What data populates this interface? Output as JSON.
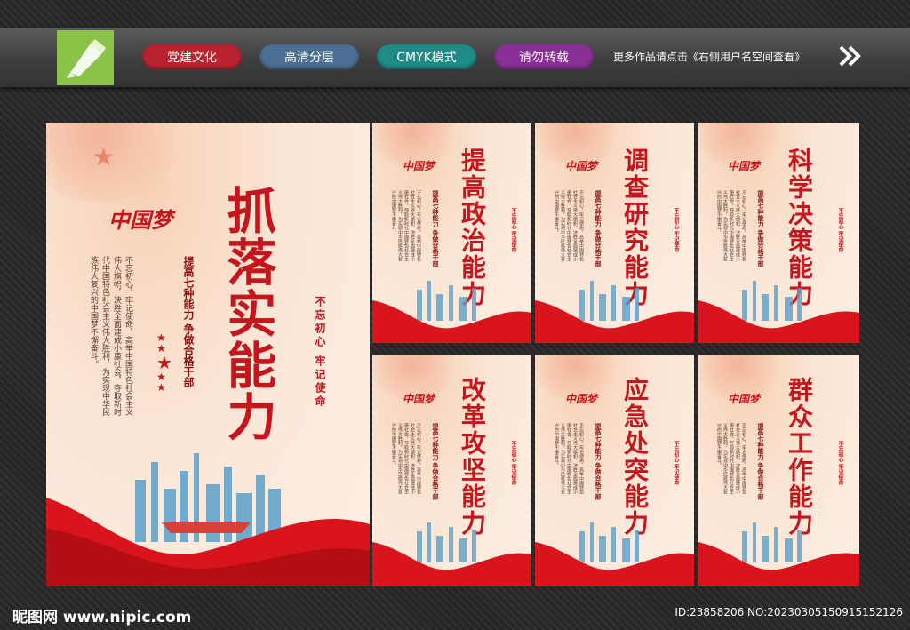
{
  "tags": [
    {
      "label": "党建文化",
      "color": "#b8232f"
    },
    {
      "label": "高清分层",
      "color": "#4b6e93"
    },
    {
      "label": "CMYK模式",
      "color": "#1f8a86"
    },
    {
      "label": "请勿转载",
      "color": "#8a2f96"
    }
  ],
  "notice": "更多作品请点击《右侧用户名空间查看》",
  "brand": "中国梦",
  "main": {
    "title": "抓落实能力",
    "subtitle": "提高七种能力 争做合格干部",
    "body": "不忘初心，牢记使命，高举中国特色社会主义伟大旗帜，决胜全面建成小康社会，夺取新时代中国特色社会主义伟大胜利，为实现中华民族伟大复兴的中国梦不懈奋斗。",
    "motto": "不忘初心 牢记使命"
  },
  "posters": [
    {
      "title": "提高政治能力"
    },
    {
      "title": "调查研究能力"
    },
    {
      "title": "科学决策能力"
    },
    {
      "title": "改革攻坚能力"
    },
    {
      "title": "应急处突能力"
    },
    {
      "title": "群众工作能力"
    }
  ],
  "footer": {
    "site": "昵图网 www.nipic.com",
    "id": "ID:23858206 NO:20230305150915152126"
  }
}
